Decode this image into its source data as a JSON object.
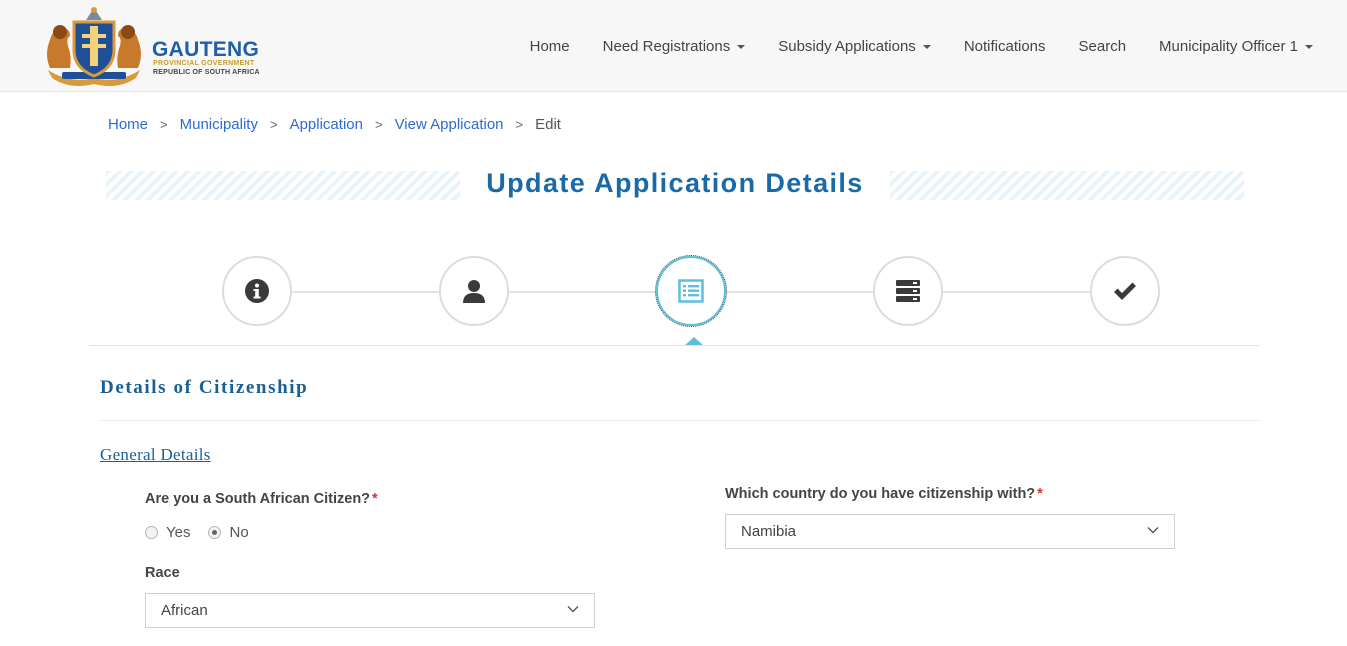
{
  "brand": {
    "name": "GAUTENG",
    "line1": "PROVINCIAL GOVERNMENT",
    "line2": "REPUBLIC OF SOUTH AFRICA",
    "primary_color": "#1f5fa8",
    "gold_color": "#c79a2b"
  },
  "nav": {
    "home": "Home",
    "need_registrations": "Need Registrations",
    "subsidy_applications": "Subsidy Applications",
    "notifications": "Notifications",
    "search": "Search",
    "user": "Municipality Officer 1"
  },
  "breadcrumb": {
    "home": "Home",
    "municipality": "Municipality",
    "application": "Application",
    "view_application": "View Application",
    "current": "Edit",
    "separator": ">"
  },
  "page_title": "Update Application Details",
  "stepper": {
    "steps": [
      {
        "icon": "info-icon"
      },
      {
        "icon": "user-icon"
      },
      {
        "icon": "list-icon"
      },
      {
        "icon": "server-icon"
      },
      {
        "icon": "check-icon"
      }
    ],
    "active_index": 2,
    "accent_color": "#5bc0de"
  },
  "section": {
    "title": "Details of Citizenship",
    "subsection": "General Details"
  },
  "form": {
    "citizen_label": "Are you a South African Citizen?",
    "required_mark": "*",
    "yes_label": "Yes",
    "no_label": "No",
    "citizen_selected": "No",
    "country_label": "Which country do you have citizenship with?",
    "country_value": "Namibia",
    "race_label": "Race",
    "race_value": "African"
  }
}
